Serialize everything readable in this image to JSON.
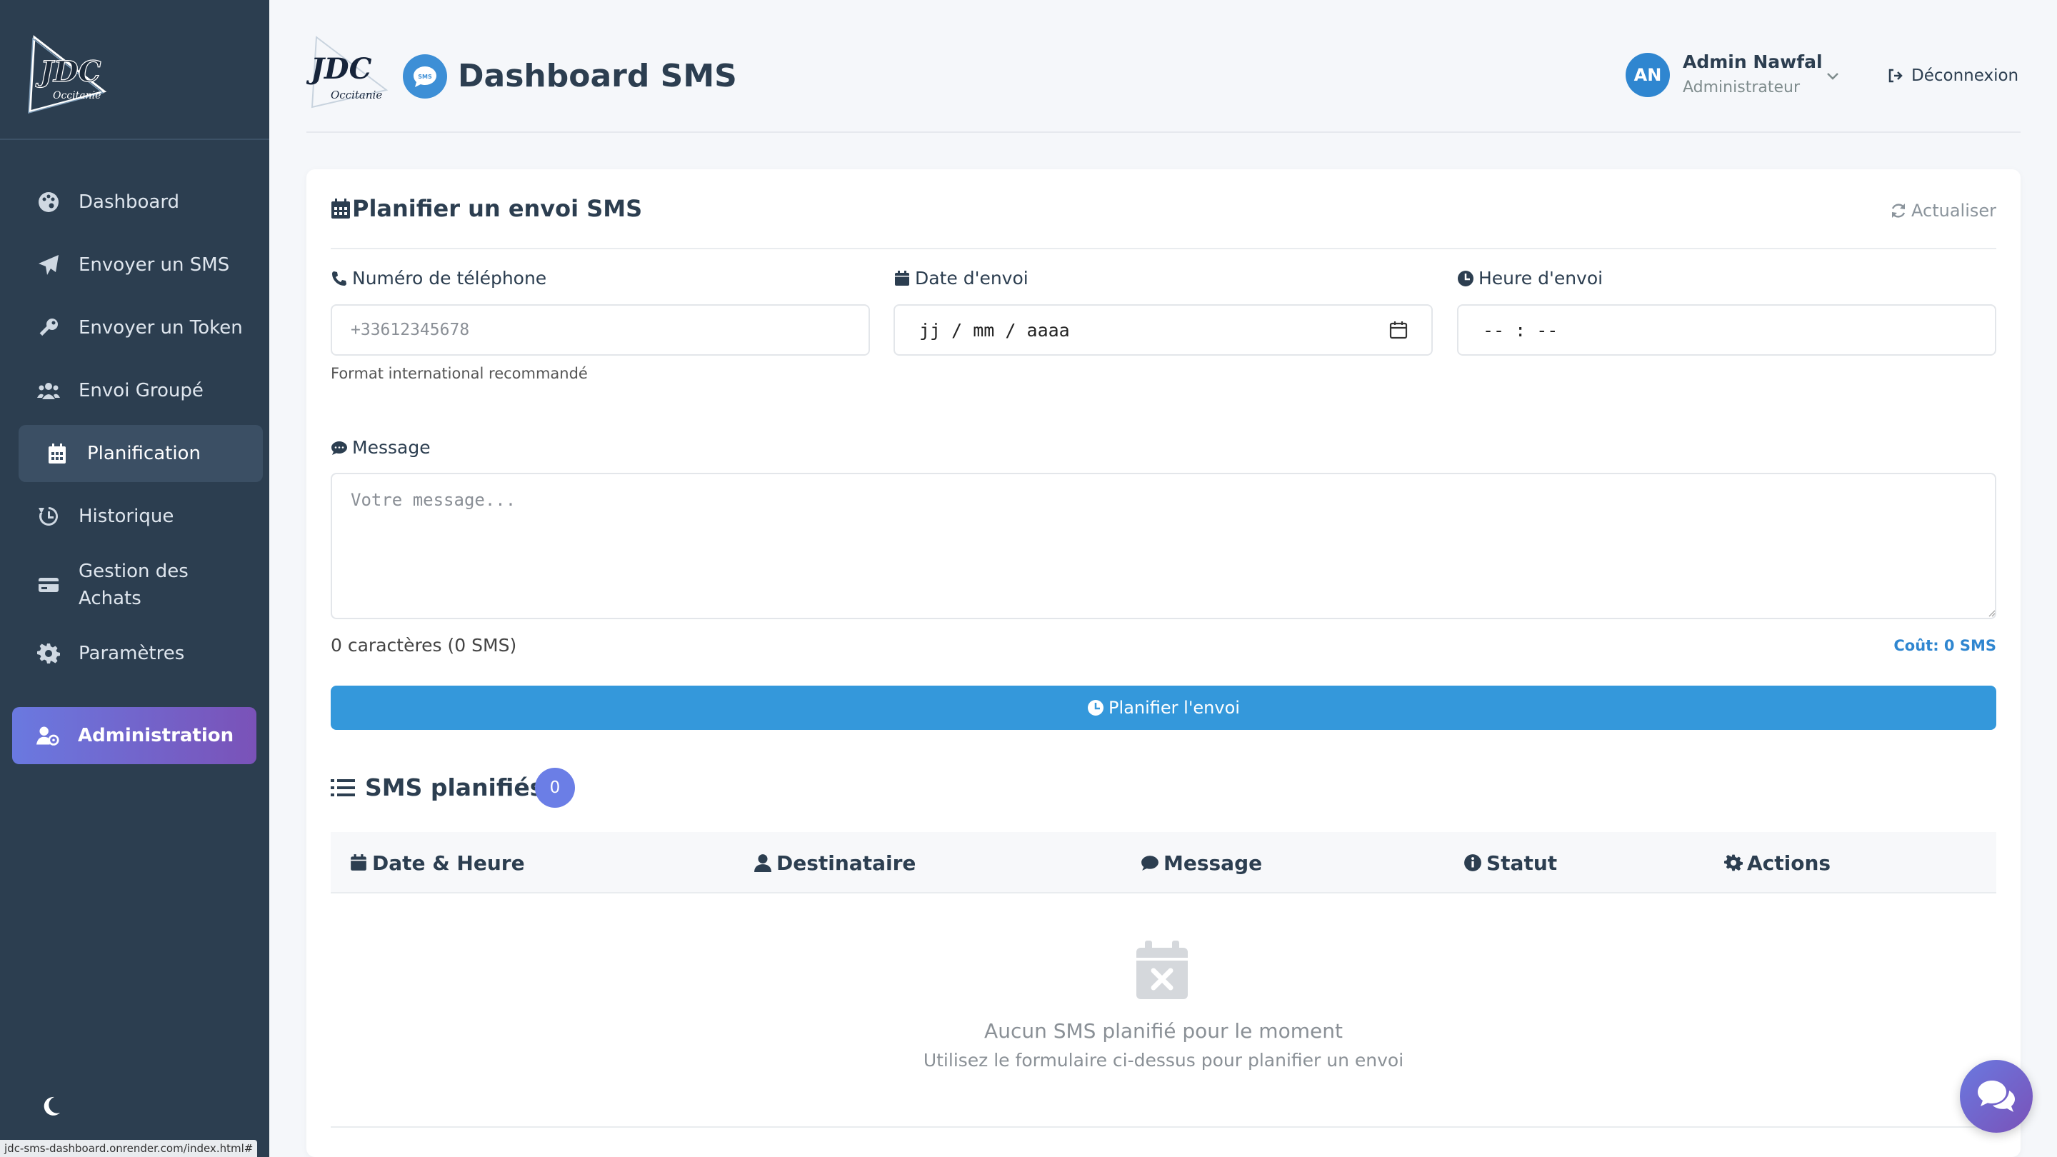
{
  "sidebar": {
    "logo_icon": "jdc-occitanie-logo",
    "items": [
      {
        "label": "Dashboard",
        "icon": "palette-icon"
      },
      {
        "label": "Envoyer un SMS",
        "icon": "paper-plane-icon"
      },
      {
        "label": "Envoyer un Token",
        "icon": "key-icon"
      },
      {
        "label": "Envoi Groupé",
        "icon": "users-icon"
      },
      {
        "label": "Planification",
        "icon": "calendar-icon"
      },
      {
        "label": "Historique",
        "icon": "history-icon"
      },
      {
        "label": "Gestion des Achats",
        "icon": "credit-card-icon"
      },
      {
        "label": "Paramètres",
        "icon": "gear-icon"
      },
      {
        "label": "Administration",
        "icon": "user-cog-icon"
      }
    ],
    "active_item": "Planification",
    "theme_toggle_icon": "moon-icon"
  },
  "status_bar": {
    "url": "jdc-sms-dashboard.onrender.com/index.html#"
  },
  "header": {
    "title": "Dashboard SMS",
    "user": {
      "initials": "AN",
      "name": "Admin Nawfal",
      "role": "Administrateur"
    },
    "logout_label": "Déconnexion"
  },
  "schedule_form": {
    "title": "Planifier un envoi SMS",
    "refresh_label": "Actualiser",
    "phone": {
      "label": "Numéro de téléphone",
      "placeholder": "+33612345678",
      "hint": "Format international recommandé"
    },
    "date": {
      "label": "Date d'envoi",
      "placeholder": "jj / mm / aaaa"
    },
    "time": {
      "label": "Heure d'envoi",
      "placeholder": "-- : --"
    },
    "message": {
      "label": "Message",
      "placeholder": "Votre message..."
    },
    "char_count": "0 caractères (0 SMS)",
    "cost": "Coût: 0 SMS",
    "submit_label": "Planifier l'envoi"
  },
  "scheduled": {
    "title": "SMS planifiés",
    "count": "0",
    "columns": [
      "Date & Heure",
      "Destinataire",
      "Message",
      "Statut",
      "Actions"
    ],
    "empty_title": "Aucun SMS planifié pour le moment",
    "empty_subtitle": "Utilisez le formulaire ci-dessus pour planifier un envoi"
  },
  "colors": {
    "sidebar_bg": "#2c3e50",
    "primary": "#3498db",
    "accent_gradient_start": "#6a79e0",
    "accent_gradient_end": "#7a52b8"
  }
}
